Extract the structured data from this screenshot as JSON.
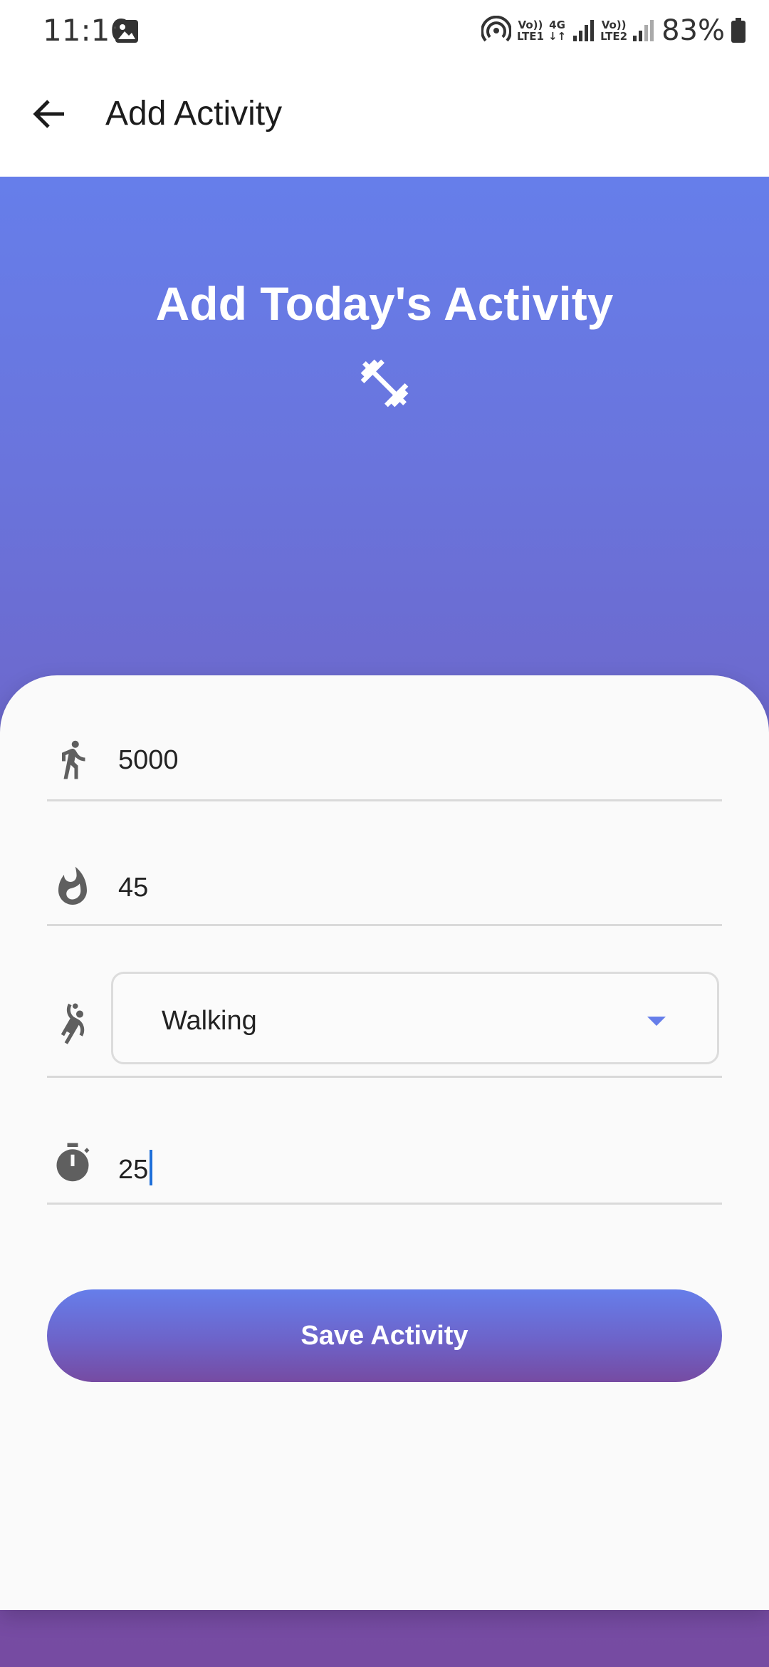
{
  "status_bar": {
    "time": "11:16",
    "battery_percent": "83%",
    "sim1_label_top": "Vo))",
    "sim1_label_bottom": "LTE1",
    "network_type": "4G",
    "sim2_label_top": "Vo))",
    "sim2_label_bottom": "LTE2"
  },
  "app_bar": {
    "title": "Add Activity",
    "back_icon": "arrow-back-icon"
  },
  "hero": {
    "title": "Add Today's Activity",
    "icon": "fitness-center-icon"
  },
  "form": {
    "steps": {
      "icon": "directions-walk-icon",
      "value": "5000"
    },
    "calories": {
      "icon": "fire-icon",
      "value": "45"
    },
    "activity_type": {
      "icon": "sports-handball-icon",
      "selected": "Walking"
    },
    "duration": {
      "icon": "timer-icon",
      "value": "25"
    },
    "save_label": "Save Activity"
  },
  "colors": {
    "gradient_start": "#667eea",
    "gradient_end": "#764ba2",
    "card_background": "#fafafa",
    "icon_grey": "#5f5f5f",
    "cursor_blue": "#1e6fd9"
  }
}
